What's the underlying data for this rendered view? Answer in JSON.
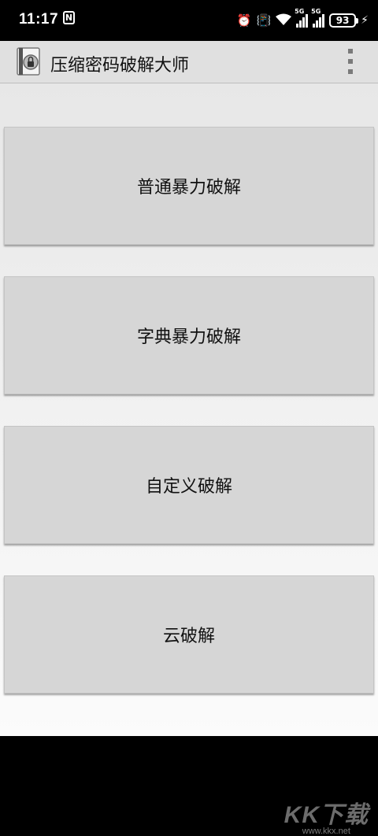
{
  "status_bar": {
    "time": "11:17",
    "nfc": "N",
    "alarm_icon": "alarm-clock-icon",
    "vibrate_icon": "vibrate-icon",
    "wifi_icon": "wifi-icon",
    "signal1_tag": "5G",
    "signal2_tag": "5G",
    "battery_level": "93",
    "charging_icon": "bolt-icon"
  },
  "app_bar": {
    "title": "压缩密码破解大师",
    "app_icon": "zip-lock-icon",
    "menu_icon": "overflow-menu-icon"
  },
  "buttons": [
    {
      "label": "普通暴力破解"
    },
    {
      "label": "字典暴力破解"
    },
    {
      "label": "自定义破解"
    },
    {
      "label": "云破解"
    }
  ],
  "watermark": {
    "brand": "KK下载",
    "url": "www.kkx.net"
  },
  "colors": {
    "app_bar_bg": "#e0e0e0",
    "button_bg": "#d6d6d6",
    "content_bg": "#ececec"
  }
}
